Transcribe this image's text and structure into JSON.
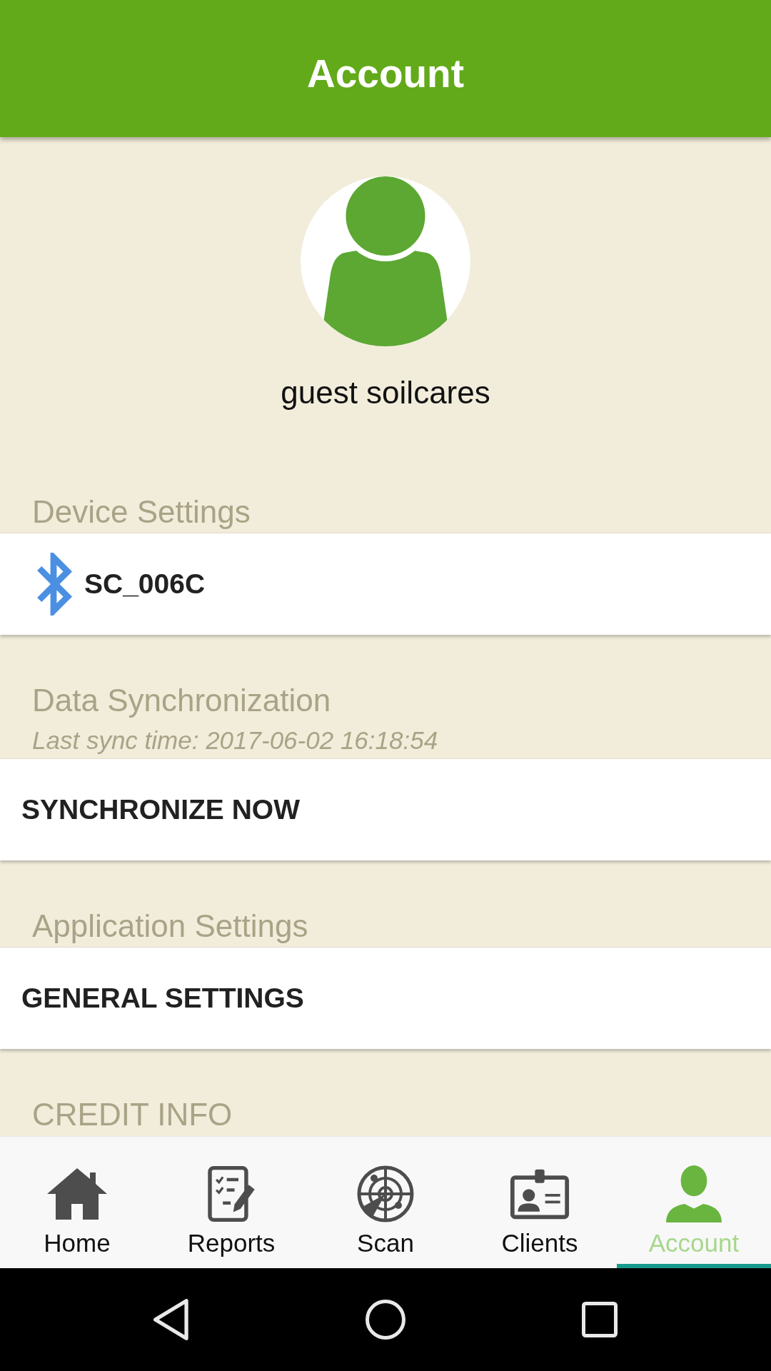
{
  "header": {
    "title": "Account"
  },
  "profile": {
    "name": "guest soilcares"
  },
  "sections": [
    {
      "title": "Device Settings",
      "items": [
        {
          "kind": "device",
          "label": "SC_006C"
        }
      ]
    },
    {
      "title": "Data Synchronization",
      "subtitle": "Last sync time: 2017-06-02 16:18:54",
      "items": [
        {
          "kind": "action",
          "label": "SYNCHRONIZE NOW"
        }
      ]
    },
    {
      "title": "Application Settings",
      "items": [
        {
          "kind": "action",
          "label": "GENERAL SETTINGS"
        }
      ]
    },
    {
      "title": "CREDIT INFO"
    }
  ],
  "bottom_nav": [
    {
      "kind": "home",
      "label": "Home",
      "selected": false
    },
    {
      "kind": "reports",
      "label": "Reports",
      "selected": false
    },
    {
      "kind": "scan",
      "label": "Scan",
      "selected": false
    },
    {
      "kind": "clients",
      "label": "Clients",
      "selected": false
    },
    {
      "kind": "account",
      "label": "Account",
      "selected": true
    }
  ]
}
